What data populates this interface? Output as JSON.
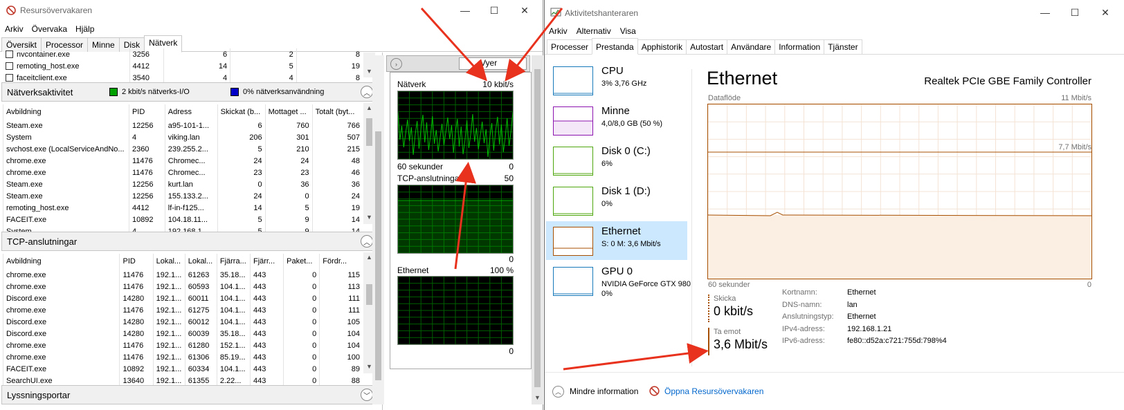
{
  "resmon": {
    "title": "Resursövervakaren",
    "menu": [
      "Arkiv",
      "Övervaka",
      "Hjälp"
    ],
    "tabs": [
      "Översikt",
      "Processor",
      "Minne",
      "Disk",
      "Nätverk"
    ],
    "active_tab": "Nätverk",
    "top_partial_rows": [
      {
        "name": "nvcontainer.exe",
        "pid": "3256",
        "a": "6",
        "b": "2",
        "c": "8"
      },
      {
        "name": "remoting_host.exe",
        "pid": "4412",
        "a": "14",
        "b": "5",
        "c": "19"
      },
      {
        "name": "faceitclient.exe",
        "pid": "3540",
        "a": "4",
        "b": "4",
        "c": "8"
      }
    ],
    "network_activity": {
      "title": "Nätverksaktivitet",
      "io_label": "2 kbit/s nätverks-I/O",
      "usage_label": "0% nätverksanvändning",
      "columns": [
        "Avbildning",
        "PID",
        "Adress",
        "Skickat (b...",
        "Mottaget ...",
        "Totalt (byt..."
      ],
      "rows": [
        [
          "Steam.exe",
          "12256",
          "a95-101-1...",
          "6",
          "760",
          "766"
        ],
        [
          "System",
          "4",
          "viking.lan",
          "206",
          "301",
          "507"
        ],
        [
          "svchost.exe (LocalServiceAndNo...",
          "2360",
          "239.255.2...",
          "5",
          "210",
          "215"
        ],
        [
          "chrome.exe",
          "11476",
          "Chromec...",
          "24",
          "24",
          "48"
        ],
        [
          "chrome.exe",
          "11476",
          "Chromec...",
          "23",
          "23",
          "46"
        ],
        [
          "Steam.exe",
          "12256",
          "kurt.lan",
          "0",
          "36",
          "36"
        ],
        [
          "Steam.exe",
          "12256",
          "155.133.2...",
          "24",
          "0",
          "24"
        ],
        [
          "remoting_host.exe",
          "4412",
          "lf-in-f125...",
          "14",
          "5",
          "19"
        ],
        [
          "FACEIT.exe",
          "10892",
          "104.18.11...",
          "5",
          "9",
          "14"
        ],
        [
          "System",
          "4",
          "192.168.1...",
          "5",
          "9",
          "14"
        ]
      ]
    },
    "tcp": {
      "title": "TCP-anslutningar",
      "columns": [
        "Avbildning",
        "PID",
        "Lokal...",
        "Lokal...",
        "Fjärra...",
        "Fjärr...",
        "Paket...",
        "Fördr..."
      ],
      "rows": [
        [
          "chrome.exe",
          "11476",
          "192.1...",
          "61263",
          "35.18...",
          "443",
          "0",
          "115"
        ],
        [
          "chrome.exe",
          "11476",
          "192.1...",
          "60593",
          "104.1...",
          "443",
          "0",
          "113"
        ],
        [
          "Discord.exe",
          "14280",
          "192.1...",
          "60011",
          "104.1...",
          "443",
          "0",
          "111"
        ],
        [
          "chrome.exe",
          "11476",
          "192.1...",
          "61275",
          "104.1...",
          "443",
          "0",
          "111"
        ],
        [
          "Discord.exe",
          "14280",
          "192.1...",
          "60012",
          "104.1...",
          "443",
          "0",
          "105"
        ],
        [
          "Discord.exe",
          "14280",
          "192.1...",
          "60039",
          "35.18...",
          "443",
          "0",
          "104"
        ],
        [
          "chrome.exe",
          "11476",
          "192.1...",
          "61280",
          "152.1...",
          "443",
          "0",
          "104"
        ],
        [
          "chrome.exe",
          "11476",
          "192.1...",
          "61306",
          "85.19...",
          "443",
          "0",
          "100"
        ],
        [
          "FACEIT.exe",
          "10892",
          "192.1...",
          "60334",
          "104.1...",
          "443",
          "0",
          "89"
        ],
        [
          "SearchUI.exe",
          "13640",
          "192.1...",
          "61355",
          "2.22...",
          "443",
          "0",
          "88"
        ]
      ]
    },
    "listening_ports": {
      "title": "Lyssningsportar"
    },
    "graphs": {
      "views_label": "Vyer",
      "network": {
        "label": "Nätverk",
        "max": "10 kbit/s",
        "time": "60 sekunder",
        "min": "0"
      },
      "tcp": {
        "label": "TCP-anslutningar",
        "max": "50",
        "min": "0"
      },
      "ethernet": {
        "label": "Ethernet",
        "max": "100 %",
        "min": "0"
      }
    }
  },
  "taskmgr": {
    "title": "Aktivitetshanteraren",
    "menu": [
      "Arkiv",
      "Alternativ",
      "Visa"
    ],
    "tabs": [
      "Processer",
      "Prestanda",
      "Apphistorik",
      "Autostart",
      "Användare",
      "Information",
      "Tjänster"
    ],
    "active_tab": "Prestanda",
    "side_items": [
      {
        "name": "CPU",
        "sub": "3% 3,76 GHz",
        "color": "#1779ba"
      },
      {
        "name": "Minne",
        "sub": "4,0/8,0 GB (50 %)",
        "color": "#8b12ae"
      },
      {
        "name": "Disk 0 (C:)",
        "sub": "6%",
        "color": "#4da60c"
      },
      {
        "name": "Disk 1 (D:)",
        "sub": "0%",
        "color": "#4da60c"
      },
      {
        "name": "Ethernet",
        "sub": "S: 0 M: 3,6 Mbit/s",
        "color": "#a74f01"
      },
      {
        "name": "GPU 0",
        "sub": "NVIDIA GeForce GTX 980",
        "sub2": "0%",
        "color": "#1779ba"
      }
    ],
    "selected_item": "Ethernet",
    "detail": {
      "title": "Ethernet",
      "adapter": "Realtek PCIe GBE Family Controller",
      "chart_label": "Dataflöde",
      "max_label": "11 Mbit/s",
      "mid_label": "7,7 Mbit/s",
      "time_label": "60 sekunder",
      "zero_label": "0",
      "send_label": "Skicka",
      "send_value": "0 kbit/s",
      "recv_label": "Ta emot",
      "recv_value": "3,6 Mbit/s",
      "props": [
        {
          "k": "Kortnamn:",
          "v": "Ethernet"
        },
        {
          "k": "DNS-namn:",
          "v": "lan"
        },
        {
          "k": "Anslutningstyp:",
          "v": "Ethernet"
        },
        {
          "k": "IPv4-adress:",
          "v": "192.168.1.21"
        },
        {
          "k": "IPv6-adress:",
          "v": "fe80::d52a:c721:755d:798%4"
        }
      ]
    },
    "footer": {
      "less_info": "Mindre information",
      "open_resmon": "Öppna Resursövervakaren"
    }
  },
  "colors": {
    "accent_ethernet": "#a74f01",
    "annotation_arrow": "#e8321e",
    "graph_green": "#00c000"
  }
}
